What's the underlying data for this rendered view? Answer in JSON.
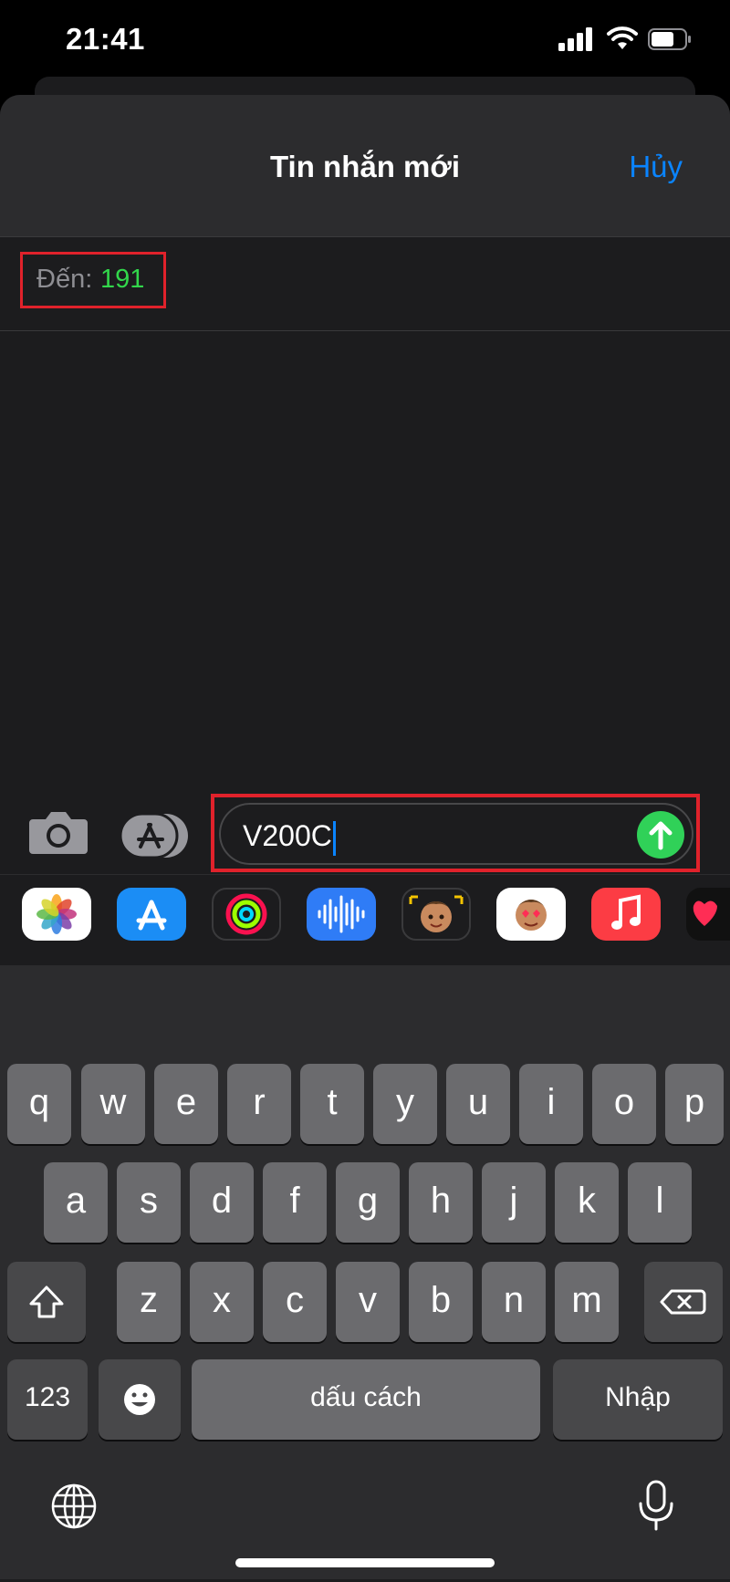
{
  "status_bar": {
    "time": "21:41",
    "icons": [
      "signal-icon",
      "wifi-icon",
      "battery-icon"
    ]
  },
  "header": {
    "title": "Tin nhắn mới",
    "cancel_label": "Hủy"
  },
  "recipient": {
    "label": "Đến:",
    "value": "191"
  },
  "compose": {
    "message_text": "V200C",
    "icons": [
      "camera-icon",
      "app-store-icon",
      "send-icon"
    ]
  },
  "app_drawer": [
    "photos-icon",
    "app-store-icon",
    "activity-icon",
    "voice-memo-icon",
    "memoji-icon",
    "memoji-stickers-icon",
    "music-icon",
    "digital-touch-icon"
  ],
  "keyboard": {
    "row1": [
      "q",
      "w",
      "e",
      "r",
      "t",
      "y",
      "u",
      "i",
      "o",
      "p"
    ],
    "row2": [
      "a",
      "s",
      "d",
      "f",
      "g",
      "h",
      "j",
      "k",
      "l"
    ],
    "row3": [
      "z",
      "x",
      "c",
      "v",
      "b",
      "n",
      "m"
    ],
    "numbers_label": "123",
    "space_label": "dấu cách",
    "return_label": "Nhập"
  },
  "colors": {
    "accent": "#0a84ff",
    "recipient": "#32d74b",
    "highlight": "#e0222b",
    "send": "#30d158"
  }
}
